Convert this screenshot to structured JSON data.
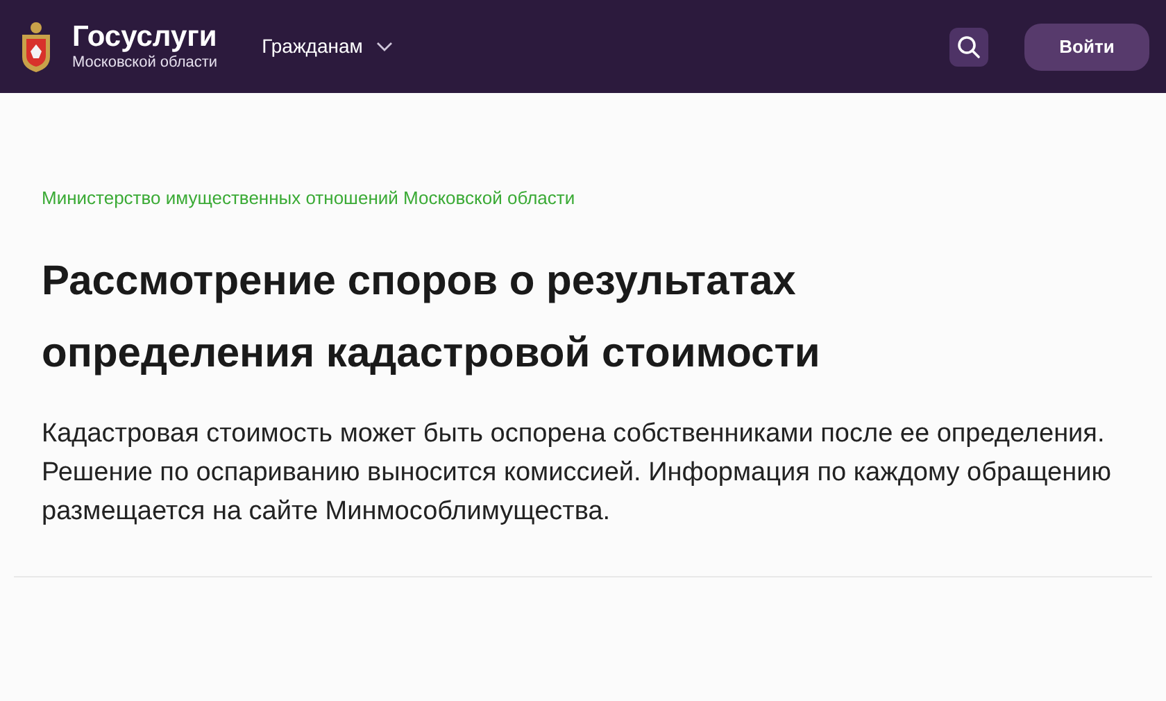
{
  "header": {
    "logo_title": "Госуслуги",
    "logo_subtitle": "Московской области",
    "nav": [
      {
        "label": "Гражданам",
        "expanded": false
      }
    ],
    "login_button": "Войти"
  },
  "breadcrumb": "Министерство имущественных отношений Московской области",
  "title": "Рассмотрение споров о результатах определения кадастровой стоимости",
  "description": "Кадастровая стоимость может быть оспорена собственниками после ее определения. Решение по оспариванию выносится комиссией. Информация по каждому обращению размещается на сайте Минмособлимущества."
}
